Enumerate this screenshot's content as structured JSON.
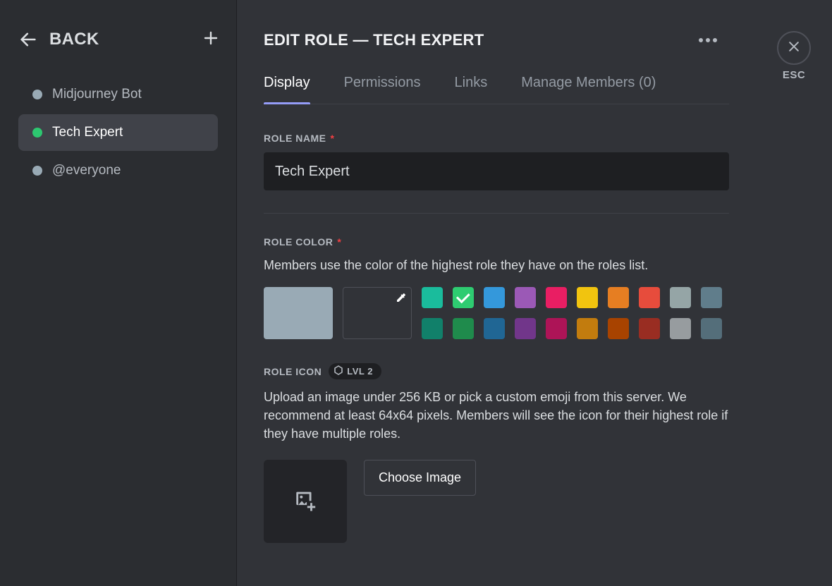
{
  "sidebar": {
    "back_label": "BACK",
    "roles": [
      {
        "label": "Midjourney Bot",
        "color": "#99aab5",
        "selected": false
      },
      {
        "label": "Tech Expert",
        "color": "#2dc770",
        "selected": true
      },
      {
        "label": "@everyone",
        "color": "#99aab5",
        "selected": false
      }
    ]
  },
  "header": {
    "title": "EDIT ROLE — TECH EXPERT",
    "esc_label": "ESC"
  },
  "tabs": {
    "display": "Display",
    "permissions": "Permissions",
    "links": "Links",
    "manage_members": "Manage Members (0)"
  },
  "role_name": {
    "label": "ROLE NAME",
    "value": "Tech Expert"
  },
  "role_color": {
    "label": "ROLE COLOR",
    "desc": "Members use the color of the highest role they have on the roles list.",
    "swatches_row1": [
      {
        "hex": "#1abc9c",
        "selected": false
      },
      {
        "hex": "#2ecc71",
        "selected": true
      },
      {
        "hex": "#3498db",
        "selected": false
      },
      {
        "hex": "#9b59b6",
        "selected": false
      },
      {
        "hex": "#e91e63",
        "selected": false
      },
      {
        "hex": "#f1c40f",
        "selected": false
      },
      {
        "hex": "#e67e22",
        "selected": false
      },
      {
        "hex": "#e74c3c",
        "selected": false
      },
      {
        "hex": "#95a5a6",
        "selected": false
      },
      {
        "hex": "#607d8b",
        "selected": false
      }
    ],
    "swatches_row2": [
      {
        "hex": "#11806a",
        "selected": false
      },
      {
        "hex": "#1f8b4c",
        "selected": false
      },
      {
        "hex": "#206694",
        "selected": false
      },
      {
        "hex": "#71368a",
        "selected": false
      },
      {
        "hex": "#ad1457",
        "selected": false
      },
      {
        "hex": "#c27c0e",
        "selected": false
      },
      {
        "hex": "#a84300",
        "selected": false
      },
      {
        "hex": "#992d22",
        "selected": false
      },
      {
        "hex": "#979c9f",
        "selected": false
      },
      {
        "hex": "#546e7a",
        "selected": false
      }
    ]
  },
  "role_icon": {
    "label": "ROLE ICON",
    "badge": "LVL 2",
    "desc": "Upload an image under 256 KB or pick a custom emoji from this server. We recommend at least 64x64 pixels. Members will see the icon for their highest role if they have multiple roles.",
    "choose_label": "Choose Image"
  }
}
